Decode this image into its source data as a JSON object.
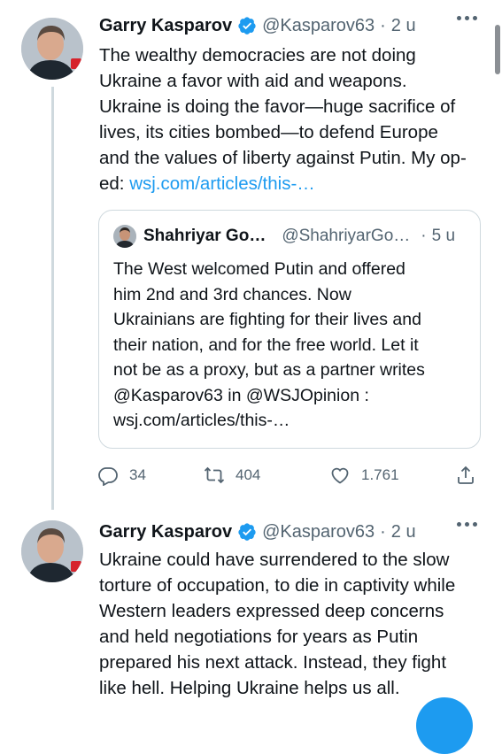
{
  "colors": {
    "accent": "#1d9bf0",
    "muted": "#536471",
    "text": "#0f1419",
    "border": "#cfd9de"
  },
  "tweet1": {
    "name": "Garry Kasparov",
    "handle": "@Kasparov63",
    "separator": "·",
    "time": "2 u",
    "lines": [
      "The wealthy democracies are not doing",
      "Ukraine a favor with aid and weapons.",
      "Ukraine is doing the favor—huge sacrifice of",
      "lives, its cities bombed—to defend Europe",
      "and the values of liberty against Putin. My op-"
    ],
    "last_line_prefix": "ed: ",
    "link": "wsj.com/articles/this-…",
    "quote": {
      "name": "Shahriyar Go…",
      "handle": "@ShahriyarGo…",
      "separator": "·",
      "time": "5 u",
      "lines": [
        "The West welcomed Putin and offered",
        "him 2nd and 3rd chances. Now",
        "Ukrainians are fighting for their lives and",
        "their nation, and for the free world. Let it",
        "not be as a proxy, but as a partner writes",
        "@Kasparov63 in @WSJOpinion :",
        "wsj.com/articles/this-…"
      ]
    },
    "actions": {
      "replies": "34",
      "retweets": "404",
      "likes": "1.761"
    }
  },
  "tweet2": {
    "name": "Garry Kasparov",
    "handle": "@Kasparov63",
    "separator": "·",
    "time": "2 u",
    "lines": [
      "Ukraine could have surrendered to the slow",
      "torture of occupation, to die in captivity while",
      "Western leaders expressed deep concerns",
      "and held negotiations for years as Putin",
      "prepared his next attack. Instead, they fight",
      "like hell. Helping Ukraine helps us all."
    ]
  }
}
